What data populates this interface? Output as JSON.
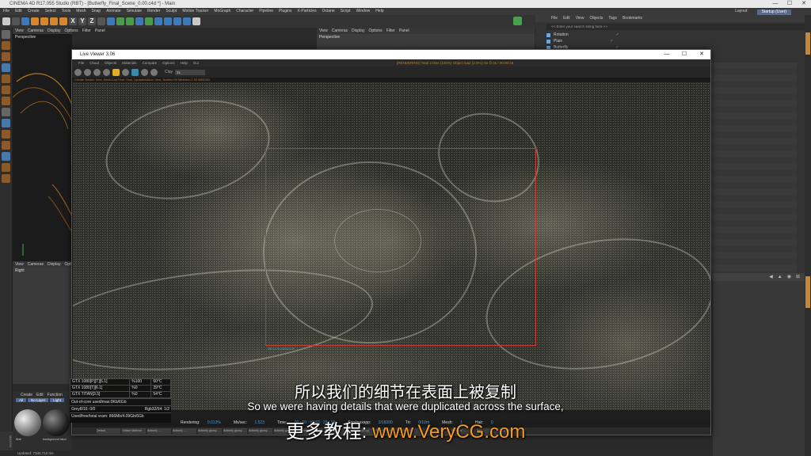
{
  "app": {
    "title": "CINEMA 4D R17.055 Studio (RBT) - [Butterfly_Final_Scene_0.00.c4d *] - Main",
    "menu": [
      "File",
      "Edit",
      "Create",
      "Select",
      "Tools",
      "Mesh",
      "Snap",
      "Animate",
      "Simulate",
      "Render",
      "Sculpt",
      "Motion Tracker",
      "MoGraph",
      "Character",
      "Pipeline",
      "Plugins",
      "X-Particles",
      "Octane",
      "Script",
      "Window",
      "Help"
    ],
    "layout_label": "Layout:",
    "layout_value": "Startup (User)",
    "window_controls": [
      "—",
      "☐",
      "✕"
    ]
  },
  "toolbar": {
    "axis_buttons": [
      "X",
      "Y",
      "Z"
    ]
  },
  "viewport_left": {
    "menu": [
      "View",
      "Cameras",
      "Display",
      "Options",
      "Filter",
      "Panel"
    ],
    "label": "Perspective"
  },
  "viewport_right": {
    "menu": [
      "View",
      "Cameras",
      "Display",
      "Optio"
    ],
    "label": "Right"
  },
  "viewport_top": {
    "menu": [
      "View",
      "Cameras",
      "Display",
      "Options",
      "Filter",
      "Panel"
    ],
    "label": "Perspective"
  },
  "object_manager": {
    "menu": [
      "File",
      "Edit",
      "View",
      "Objects",
      "Tags",
      "Bookmarks"
    ],
    "search_placeholder": "<< Enter your search string here >>",
    "objects": [
      "Rotation",
      "Plain",
      "Butterfly"
    ]
  },
  "attributes": {
    "nav": [
      "◀",
      "▲",
      "◉",
      "⊞"
    ]
  },
  "material_manager": {
    "menu": [
      "Create",
      "Edit",
      "Function"
    ],
    "tabs": [
      "All",
      "No Layer",
      "Light"
    ],
    "materials": [
      "Mat",
      "background stud"
    ]
  },
  "live_viewer": {
    "title": "Live Viewer 3.06",
    "menu": [
      "File",
      "Cloud",
      "Objects",
      "Materials",
      "Compare",
      "Options",
      "Help",
      "Gui"
    ],
    "info": "[RENDERING] Total 2.0ms (100%)  Object load (2.0%)  ms    ⏱ 0s / 00:00:15",
    "clay_label": "Clay",
    "clay_value": "3x",
    "status_line": "Create Nodes: 0ms,  MeshCalcTime: 0ms,  Update&Alloc: 0ms,  Nodes=00  Meshes=1  50 MiB/280",
    "region_label": "REGION RENDER"
  },
  "gpu_stats": {
    "rows": [
      {
        "name": "GTX 1080[P][T][6.1]",
        "load": "%100",
        "temp": "60°C"
      },
      {
        "name": "GTX 1080[T][6.1]",
        "load": "%0",
        "temp": "39°C"
      },
      {
        "name": "GTX TITAN[3.5]",
        "load": "%0",
        "temp": "54°C"
      }
    ],
    "out_of_core": "Out-of-core used/max:0Kb/6Gb",
    "grey": "Grey8/16: 0/0",
    "rgb": "Rgb32/64: 1/2",
    "vram": "Used/free/total vram: 866Mb/4.09Gb/6Gb"
  },
  "render_stats": {
    "rendering_label": "Rendering:",
    "rendering_value": "0.013%",
    "mssec_label": "Ms/sec:",
    "mssec_value": "1.523",
    "time_label": "Time:",
    "time_value": "00 : 00 : 01/43 : 29 : 18",
    "spp_label": "Spp/maxspp:",
    "spp_value": "2/16000",
    "tri_label": "Tri:",
    "tri_value": "0/10m",
    "mesh_label": "Mesh:",
    "mesh_value": "1",
    "hair_label": "Hair:",
    "hair_value": "0"
  },
  "bottom_tabs": [
    "Default",
    "Octane Material",
    "Butterfly ...",
    "Butterfly ...",
    "Butterfly glossy",
    "Butterfly glossy",
    "Butterfly glossy",
    "Butterfly glossy",
    "Butterfly glossy",
    "Butterfly ...",
    "Butterfly glossy",
    "Butterfly glossy",
    "Butterfly ...",
    "Butterfly ...",
    "light mat",
    "light ...",
    "light mat"
  ],
  "subtitles": {
    "chinese": "所以我们的细节在表面上被复制",
    "english": "So we were having details that were duplicated across the surface,",
    "watermark_prefix": "更多教程:",
    "watermark_url": "www.VeryCG.com"
  },
  "statusbar": "Updated: 7345.710 ms"
}
